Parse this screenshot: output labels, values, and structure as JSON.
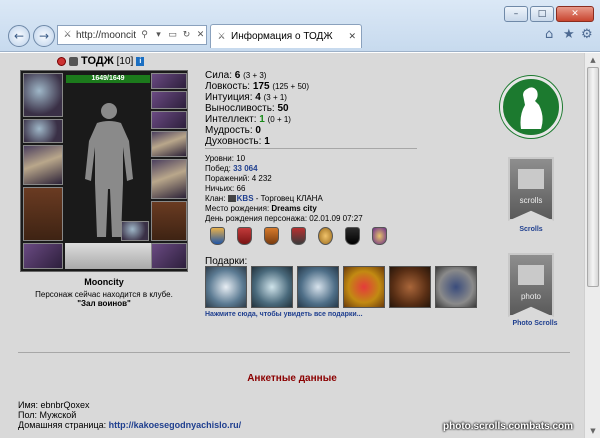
{
  "browser": {
    "address": "http://mooncit",
    "tab_title": "Информация о ТОДЖ",
    "back_glyph": "←",
    "forward_glyph": "→",
    "icons": [
      "search-icon",
      "dropdown-icon",
      "refresh-icon",
      "stop-icon",
      "home-icon",
      "favorites-star-icon",
      "gear-icon"
    ]
  },
  "character": {
    "name": "ТОДЖ",
    "level": "[10]",
    "hp": "1649/1649",
    "nickname": "Mooncity",
    "location": "Персонаж сейчас находится в клубе.",
    "room": "\"Зал воинов\""
  },
  "stats": [
    {
      "label": "Сила:",
      "value": "6",
      "bonus": "(3 + 3)"
    },
    {
      "label": "Ловкость:",
      "value": "175",
      "bonus": "(125 + 50)"
    },
    {
      "label": "Интуиция:",
      "value": "4",
      "bonus": "(3 + 1)"
    },
    {
      "label": "Выносливость:",
      "value": "50",
      "bonus": ""
    },
    {
      "label": "Интеллект:",
      "value": "1",
      "bonus": "(0 + 1)"
    },
    {
      "label": "Мудрость:",
      "value": "0",
      "bonus": ""
    },
    {
      "label": "Духовность:",
      "value": "1",
      "bonus": ""
    }
  ],
  "info": {
    "levels": "Уровни: 10",
    "wins_label": "Побед:",
    "wins": "33 064",
    "losses": "Поражений: 4 232",
    "draws": "Ничьих: 66",
    "clan_label": "Клан:",
    "clan_name": "KBS",
    "clan_rank": "- Торговец КЛАНА",
    "birthplace_label": "Место рождения:",
    "birthplace": "Dreams city",
    "birthday": "День рождения персонажа: 02.01.09 07:27"
  },
  "gifts": {
    "title": "Подарки:",
    "link": "Нажмите сюда, чтобы увидеть все подарки..."
  },
  "sidebar": {
    "scrolls_label": "Scrolls",
    "photo_scrolls_label": "Photo Scrolls",
    "scrolls_banner_text": "scrolls",
    "photo_banner_text": "photo"
  },
  "profile": {
    "section_title": "Анкетные данные",
    "name_row": "Имя: ebnbrQoxex",
    "gender_row": "Пол: Мужской",
    "homepage_label": "Домашняя страница:",
    "homepage": "http://kakoesegodnyachislo.ru/"
  },
  "watermark": "photo.scrolls.combats.com",
  "colors": {
    "page_bg": "#d9d9d9",
    "link": "#1f3f8f",
    "section_title": "#8b0000",
    "shield": "#1c7a2f"
  }
}
